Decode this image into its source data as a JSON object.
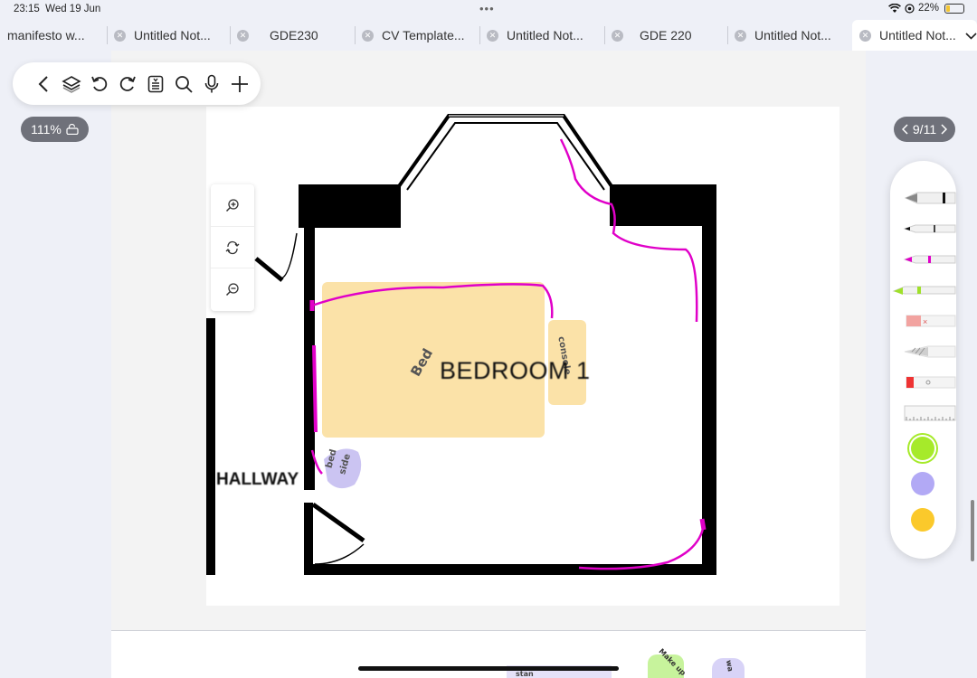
{
  "status": {
    "time": "23:15",
    "date": "Wed 19 Jun",
    "battery": "22%",
    "battery_level": 0.22
  },
  "tabs": [
    {
      "label": "manifesto w...",
      "closable": false
    },
    {
      "label": "Untitled Not...",
      "closable": true
    },
    {
      "label": "GDE230",
      "closable": true
    },
    {
      "label": "CV Template...",
      "closable": true
    },
    {
      "label": "Untitled Not...",
      "closable": true
    },
    {
      "label": "GDE 220",
      "closable": true
    },
    {
      "label": "Untitled Not...",
      "closable": true
    },
    {
      "label": "Untitled Not...",
      "closable": true,
      "active": true
    }
  ],
  "toolbar": {
    "icons": [
      "back-icon",
      "layers-icon",
      "undo-icon",
      "redo-icon",
      "page-list-icon",
      "search-icon",
      "microphone-icon",
      "add-icon"
    ]
  },
  "zoom": {
    "value": "111%"
  },
  "page_indicator": {
    "label": "9/11"
  },
  "drawing": {
    "room": "BEDROOM 1",
    "hallway": "HALLWAY",
    "bed": "Bed",
    "console": "console",
    "bedside_line1": "bed",
    "bedside_line2": "side",
    "bottom_note1": "Make up",
    "bottom_note2": "wa",
    "bottom_note3": "stan"
  },
  "palette": {
    "tools": [
      "fountain-pen-icon",
      "ballpoint-pen-icon",
      "pink-pen-icon",
      "highlighter-icon",
      "eraser-icon",
      "pencil-icon",
      "marker-icon",
      "ruler-icon"
    ],
    "colors": [
      "#a6ea2a",
      "#b2a9f5",
      "#fbc92b"
    ]
  },
  "colors": {
    "highlight_pink": "#e000c8",
    "bed_fill": "#fbe2a8",
    "bedside_fill": "#cbc4f2",
    "accent_green": "#9fe02a"
  }
}
